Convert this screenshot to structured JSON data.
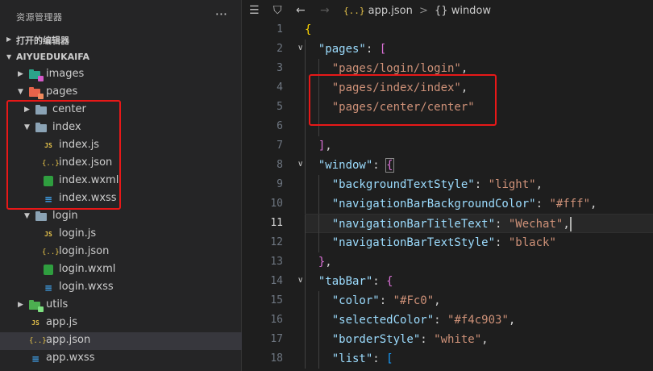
{
  "sidebar": {
    "title": "资源管理器",
    "more": "···",
    "open_editors": "打开的编辑器",
    "project": "AIYUEDUKAIFA",
    "tree": [
      {
        "name": "images",
        "type": "folder",
        "indent": 1,
        "twist": "▸",
        "color": "#2ba38a"
      },
      {
        "name": "pages",
        "type": "folder-open",
        "indent": 1,
        "twist": "▾",
        "color": "#e8634a"
      },
      {
        "name": "center",
        "type": "folder",
        "indent": 2,
        "twist": "▸",
        "color": "#8ba3b5"
      },
      {
        "name": "index",
        "type": "folder-open",
        "indent": 2,
        "twist": "▾",
        "color": "#8ba3b5"
      },
      {
        "name": "index.js",
        "type": "js",
        "indent": 3
      },
      {
        "name": "index.json",
        "type": "json",
        "indent": 3
      },
      {
        "name": "index.wxml",
        "type": "wxml",
        "indent": 3
      },
      {
        "name": "index.wxss",
        "type": "wxss",
        "indent": 3
      },
      {
        "name": "login",
        "type": "folder-open",
        "indent": 2,
        "twist": "▾",
        "color": "#8ba3b5"
      },
      {
        "name": "login.js",
        "type": "js",
        "indent": 3
      },
      {
        "name": "login.json",
        "type": "json",
        "indent": 3
      },
      {
        "name": "login.wxml",
        "type": "wxml",
        "indent": 3
      },
      {
        "name": "login.wxss",
        "type": "wxss",
        "indent": 3
      },
      {
        "name": "utils",
        "type": "folder",
        "indent": 1,
        "twist": "▸",
        "color": "#4caf50"
      },
      {
        "name": "app.js",
        "type": "js",
        "indent": 1
      },
      {
        "name": "app.json",
        "type": "json",
        "indent": 1,
        "selected": true
      },
      {
        "name": "app.wxss",
        "type": "wxss",
        "indent": 1
      }
    ]
  },
  "editor": {
    "breadcrumb_file_icon": "{..}",
    "breadcrumb_file": "app.json",
    "breadcrumb_sep": ">",
    "breadcrumb_symbol_icon": "{}",
    "breadcrumb_symbol": "window",
    "line_numbers": [
      "1",
      "2",
      "3",
      "4",
      "5",
      "6",
      "7",
      "8",
      "9",
      "10",
      "11",
      "12",
      "13",
      "14",
      "15",
      "16",
      "17",
      "18"
    ],
    "active_line": "11",
    "lines": [
      [
        {
          "c": "b1",
          "t": "{"
        }
      ],
      [
        {
          "c": "p",
          "t": "  "
        },
        {
          "c": "k",
          "t": "\"pages\""
        },
        {
          "c": "p",
          "t": ": "
        },
        {
          "c": "b2",
          "t": "["
        }
      ],
      [
        {
          "c": "p",
          "t": "    "
        },
        {
          "c": "s",
          "t": "\"pages/login/login\""
        },
        {
          "c": "p",
          "t": ","
        }
      ],
      [
        {
          "c": "p",
          "t": "    "
        },
        {
          "c": "s",
          "t": "\"pages/index/index\""
        },
        {
          "c": "p",
          "t": ","
        }
      ],
      [
        {
          "c": "p",
          "t": "    "
        },
        {
          "c": "s",
          "t": "\"pages/center/center\""
        }
      ],
      [
        {
          "c": "p",
          "t": ""
        }
      ],
      [
        {
          "c": "p",
          "t": "  "
        },
        {
          "c": "b2",
          "t": "]"
        },
        {
          "c": "p",
          "t": ","
        }
      ],
      [
        {
          "c": "p",
          "t": "  "
        },
        {
          "c": "k",
          "t": "\"window\""
        },
        {
          "c": "p",
          "t": ": "
        },
        {
          "c": "b2",
          "t": "{"
        }
      ],
      [
        {
          "c": "p",
          "t": "    "
        },
        {
          "c": "k",
          "t": "\"backgroundTextStyle\""
        },
        {
          "c": "p",
          "t": ": "
        },
        {
          "c": "s",
          "t": "\"light\""
        },
        {
          "c": "p",
          "t": ","
        }
      ],
      [
        {
          "c": "p",
          "t": "    "
        },
        {
          "c": "k",
          "t": "\"navigationBarBackgroundColor\""
        },
        {
          "c": "p",
          "t": ": "
        },
        {
          "c": "s",
          "t": "\"#fff\""
        },
        {
          "c": "p",
          "t": ","
        }
      ],
      [
        {
          "c": "p",
          "t": "    "
        },
        {
          "c": "k",
          "t": "\"navigationBarTitleText\""
        },
        {
          "c": "p",
          "t": ": "
        },
        {
          "c": "s",
          "t": "\"Wechat\""
        },
        {
          "c": "p",
          "t": ","
        }
      ],
      [
        {
          "c": "p",
          "t": "    "
        },
        {
          "c": "k",
          "t": "\"navigationBarTextStyle\""
        },
        {
          "c": "p",
          "t": ": "
        },
        {
          "c": "s",
          "t": "\"black\""
        }
      ],
      [
        {
          "c": "p",
          "t": "  "
        },
        {
          "c": "b2",
          "t": "}"
        },
        {
          "c": "p",
          "t": ","
        }
      ],
      [
        {
          "c": "p",
          "t": "  "
        },
        {
          "c": "k",
          "t": "\"tabBar\""
        },
        {
          "c": "p",
          "t": ": "
        },
        {
          "c": "b2",
          "t": "{"
        }
      ],
      [
        {
          "c": "p",
          "t": "    "
        },
        {
          "c": "k",
          "t": "\"color\""
        },
        {
          "c": "p",
          "t": ": "
        },
        {
          "c": "s",
          "t": "\"#Fc0\""
        },
        {
          "c": "p",
          "t": ","
        }
      ],
      [
        {
          "c": "p",
          "t": "    "
        },
        {
          "c": "k",
          "t": "\"selectedColor\""
        },
        {
          "c": "p",
          "t": ": "
        },
        {
          "c": "s",
          "t": "\"#f4c903\""
        },
        {
          "c": "p",
          "t": ","
        }
      ],
      [
        {
          "c": "p",
          "t": "    "
        },
        {
          "c": "k",
          "t": "\"borderStyle\""
        },
        {
          "c": "p",
          "t": ": "
        },
        {
          "c": "s",
          "t": "\"white\""
        },
        {
          "c": "p",
          "t": ","
        }
      ],
      [
        {
          "c": "p",
          "t": "    "
        },
        {
          "c": "k",
          "t": "\"list\""
        },
        {
          "c": "p",
          "t": ": "
        },
        {
          "c": "b3",
          "t": "["
        }
      ]
    ]
  },
  "colors": {
    "annotation": "#e81818",
    "string": "#ce9178",
    "key": "#9cdcfe"
  }
}
